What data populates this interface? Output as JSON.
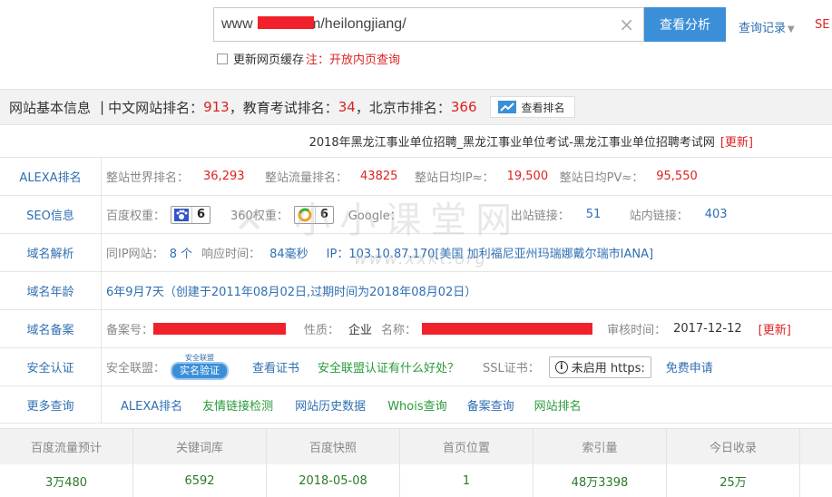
{
  "search": {
    "url_prefix": "www",
    "url_suffix": ".com/heilongjiang/",
    "button": "查看分析",
    "history": "查询记录",
    "se": "SE"
  },
  "cache": {
    "label": "更新网页缓存",
    "note": "注：开放内页查询"
  },
  "info_bar": {
    "title": "网站基本信息",
    "sep": "|",
    "cn_rank_label": "中文网站排名：",
    "cn_rank": "913",
    "edu_rank_label": "，教育考试排名：",
    "edu_rank": "34",
    "bj_rank_label": "，北京市排名：",
    "bj_rank": "366",
    "rank_button": "查看排名"
  },
  "page_title": {
    "text": "2018年黑龙江事业单位招聘_黑龙江事业单位考试-黑龙江事业单位招聘考试网",
    "update": "[更新]"
  },
  "rows": {
    "alexa": {
      "label": "ALEXA排名",
      "world_label": "整站世界排名：",
      "world": "36,293",
      "traffic_label": "整站流量排名：",
      "traffic": "43825",
      "ip_label": "整站日均IP≈：",
      "ip": "19,500",
      "pv_label": "整站日均PV≈：",
      "pv": "95,550"
    },
    "seo": {
      "label": "SEO信息",
      "baidu_label": "百度权重：",
      "baidu": "6",
      "s360_label": "360权重：",
      "s360": "6",
      "google_label": "Google：",
      "out_label": "出站链接：",
      "out": "51",
      "in_label": "站内链接：",
      "in": "403"
    },
    "dns": {
      "label": "域名解析",
      "sameip_label": "同IP网站：",
      "sameip": "8 个",
      "resp_label": "响应时间：",
      "resp": "84毫秒",
      "ip_text": "IP：103.10.87.170[美国 加利福尼亚州玛瑞娜戴尔瑞市IANA]"
    },
    "age": {
      "label": "域名年龄",
      "text": "6年9月7天（创建于2011年08月02日,过期时间为2018年08月02日）"
    },
    "icp": {
      "label": "域名备案",
      "num_label": "备案号：",
      "type_label": "性质：",
      "type": "企业",
      "name_label": "名称：",
      "audit_label": "审核时间：",
      "audit": "2017-12-12",
      "update": "[更新]"
    },
    "security": {
      "label": "安全认证",
      "alliance_label": "安全联盟：",
      "shield_top": "安全联盟",
      "shield": "实名验证",
      "cert": "查看证书",
      "benefit": "安全联盟认证有什么好处？",
      "ssl_label": "SSL证书：",
      "https": "未启用 https:",
      "apply": "免费申请"
    },
    "more": {
      "label": "更多查询",
      "links": [
        "ALEXA排名",
        "友情链接检测",
        "网站历史数据",
        "Whois查询",
        "备案查询",
        "网站排名"
      ]
    }
  },
  "stats": {
    "headers": [
      "百度流量预计",
      "关键词库",
      "百度快照",
      "首页位置",
      "索引量",
      "今日收录"
    ],
    "values": [
      "3万480",
      "6592",
      "2018-05-08",
      "1",
      "48万3398",
      "25万"
    ]
  },
  "watermark": {
    "text": "小小课堂网",
    "url": "www.xxkt.org"
  },
  "colors": {
    "accent": "#3b8fd8",
    "link": "#2f6fb2",
    "red": "#d22",
    "green": "#2a9a3a"
  }
}
